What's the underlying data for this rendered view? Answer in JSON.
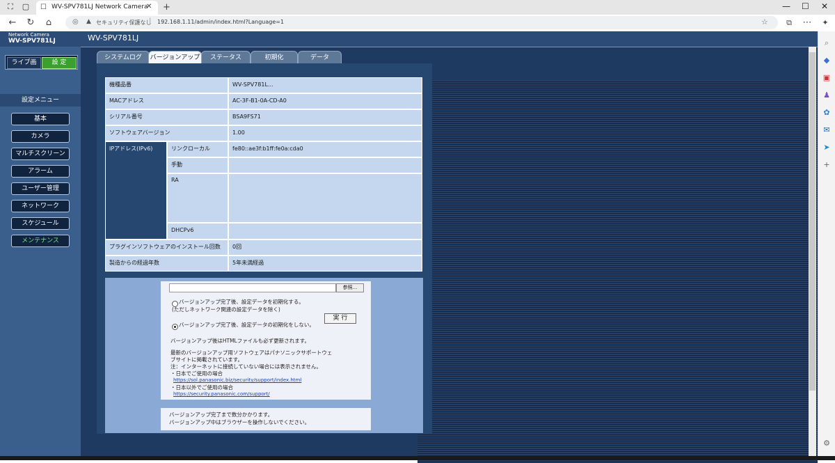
{
  "browser": {
    "tab_icon": "☐",
    "tab_title": "WV-SPV781LJ Network Camera",
    "url": "192.168.1.11/admin/index.html?Language=1",
    "security_label": "セキュリティ保護なし",
    "colors": {
      "chrome": "#e6e6e6",
      "accent": "#2c4c77"
    }
  },
  "camera": {
    "brand": "Network Camera",
    "model_small": "WV-SPV781LJ",
    "model": "WV-SPV781LJ",
    "mode_live": "ライブ画",
    "mode_setup": "設 定",
    "menu_title": "設定メニュー",
    "menu_items": [
      "基本",
      "カメラ",
      "マルチスクリーン",
      "アラーム",
      "ユーザー管理",
      "ネットワーク",
      "スケジュール",
      "メンテナンス"
    ],
    "active_menu": "メンテナンス",
    "tabs": [
      "システムログ",
      "バージョンアップ",
      "ステータス",
      "初期化",
      "データ"
    ],
    "active_tab": "バージョンアップ"
  },
  "info_table": {
    "rows": [
      {
        "label": "機種品番",
        "value": "WV-SPV781L..."
      },
      {
        "label": "MACアドレス",
        "value": "AC-3F-B1-0A-CD-A0"
      },
      {
        "label": "シリアル番号",
        "value": "BSA9FS71"
      },
      {
        "label": "ソフトウェアバージョン",
        "value": "1.00"
      }
    ],
    "ipv6_label": "IPアドレス(IPv6)",
    "ipv6_rows": [
      {
        "label": "リンクローカル",
        "value": "fe80::ae3f:b1ff:fe0a:cda0"
      },
      {
        "label": "手動",
        "value": ""
      },
      {
        "label": "RA",
        "value": ""
      },
      {
        "label": "DHCPv6",
        "value": ""
      }
    ],
    "bottom_rows": [
      {
        "label": "プラグインソフトウェアのインストール回数",
        "value": "0回"
      },
      {
        "label": "製造からの経過年数",
        "value": "5年未満経過"
      }
    ]
  },
  "upgrade": {
    "browse_label": "参照...",
    "option1_line1": "バージョンアップ完了後、設定データを初期化する。",
    "option1_line2": "(ただしネットワーク関連の設定データを除く)",
    "option2": "バージョンアップ完了後、設定データの初期化をしない。",
    "execute_label": "実 行",
    "notice": "バージョンアップ後はHTMLファイルも必ず更新されます。",
    "info_lines": [
      "最新のバージョンアップ用ソフトウェアはパナソニックサポートウェ",
      "ブサイトに掲載されています。",
      "注：インターネットに接続していない場合には表示されません。",
      "・日本でご使用の場合"
    ],
    "link_jp": "https://sol.panasonic.biz/security/support/index.html",
    "overseas_label": "・日本以外でご使用の場合",
    "link_global": "https://security.panasonic.com/support/",
    "note_line1": "バージョンアップ完了まで数分かかります。",
    "note_line2": "バージョンアップ中はブラウザーを操作しないでください。"
  }
}
